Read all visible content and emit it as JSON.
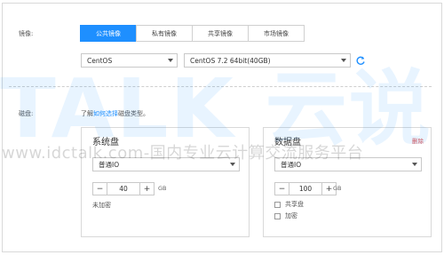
{
  "image_label": "镜像:",
  "image_tabs": [
    "公共镜像",
    "私有镜像",
    "共享镜像",
    "市场镜像"
  ],
  "os_select": "CentOS",
  "version_select": "CentOS 7.2 64bit(40GB)",
  "disk_label": "磁盘:",
  "disk_hint": {
    "prefix": "了解",
    "link": "如何选择",
    "suffix": "磁盘类型。"
  },
  "system_disk": {
    "title": "系统盘",
    "type_select": "普通IO",
    "size": "40",
    "unit": "GB",
    "minus": "−",
    "plus": "+",
    "note": "未加密"
  },
  "data_disk": {
    "title": "数据盘",
    "delete_label": "删除",
    "type_select": "普通IO",
    "size": "100",
    "unit": "GB",
    "minus": "−",
    "plus": "+",
    "shared_label": "共享盘",
    "encrypt_label": "加密"
  },
  "watermark": {
    "logo": "TALK 云说",
    "line": "www.idctalk.com-国内专业云计算交流服务平台"
  },
  "colors": {
    "accent": "#1e8fff",
    "danger": "#e05050"
  }
}
